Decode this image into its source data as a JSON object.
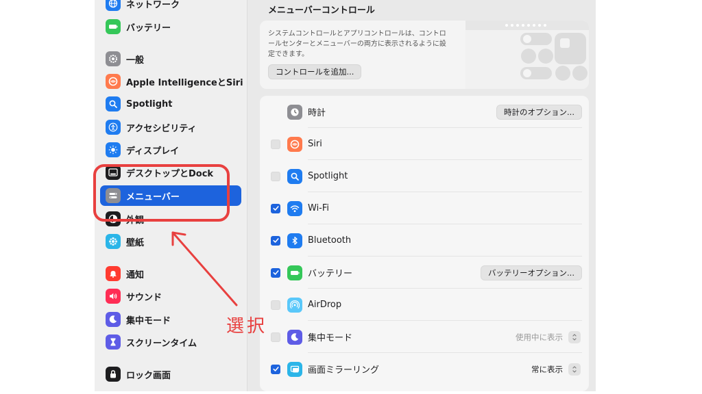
{
  "sidebar": {
    "items": [
      {
        "label": "ネットワーク",
        "icon": "globe-icon",
        "color": "#1f7cf0"
      },
      {
        "label": "バッテリー",
        "icon": "battery-icon",
        "color": "#35c759"
      },
      {
        "label": "一般",
        "icon": "gear-icon",
        "color": "#8e8e93"
      },
      {
        "label": "Apple IntelligenceとSiri",
        "icon": "siri-icon",
        "color": "#ff7a4d"
      },
      {
        "label": "Spotlight",
        "icon": "magnifier-icon",
        "color": "#1f7cf0"
      },
      {
        "label": "アクセシビリティ",
        "icon": "accessibility-icon",
        "color": "#1f7cf0"
      },
      {
        "label": "ディスプレイ",
        "icon": "sun-icon",
        "color": "#1f7cf0"
      },
      {
        "label": "デスクトップとDock",
        "icon": "dock-icon",
        "color": "#1d1d1f"
      },
      {
        "label": "メニューバー",
        "icon": "menubar-icon",
        "color": "#8e8e93",
        "selected": true
      },
      {
        "label": "外観",
        "icon": "appearance-icon",
        "color": "#1d1d1f"
      },
      {
        "label": "壁紙",
        "icon": "wallpaper-icon",
        "color": "#2bb5e8"
      },
      {
        "label": "通知",
        "icon": "bell-icon",
        "color": "#ff3b30"
      },
      {
        "label": "サウンド",
        "icon": "speaker-icon",
        "color": "#ff2d55"
      },
      {
        "label": "集中モード",
        "icon": "moon-icon",
        "color": "#5e5ce6"
      },
      {
        "label": "スクリーンタイム",
        "icon": "hourglass-icon",
        "color": "#5e5ce6"
      },
      {
        "label": "ロック画面",
        "icon": "lock-icon",
        "color": "#1d1d1f"
      }
    ]
  },
  "main": {
    "title": "メニューバーコントロール",
    "info_text": "システムコントロールとアプリコントロールは、コントロールセンターとメニューバーの両方に表示されるように設定できます。",
    "add_button": "コントロールを追加...",
    "rows": [
      {
        "label": "時計",
        "icon": "clock-icon",
        "color": "#8e8e93",
        "checkbox": null,
        "button": "時計のオプション..."
      },
      {
        "label": "Siri",
        "icon": "siri-icon",
        "color": "#ff7a4d",
        "checkbox": false
      },
      {
        "label": "Spotlight",
        "icon": "magnifier-icon",
        "color": "#1f7cf0",
        "checkbox": false
      },
      {
        "label": "Wi-Fi",
        "icon": "wifi-icon",
        "color": "#1f7cf0",
        "checkbox": true
      },
      {
        "label": "Bluetooth",
        "icon": "bluetooth-icon",
        "color": "#1f7cf0",
        "checkbox": true
      },
      {
        "label": "バッテリー",
        "icon": "battery-icon",
        "color": "#35c759",
        "checkbox": true,
        "button": "バッテリーオプション..."
      },
      {
        "label": "AirDrop",
        "icon": "airdrop-icon",
        "color": "#5ac8fa",
        "checkbox": false
      },
      {
        "label": "集中モード",
        "icon": "moon-icon",
        "color": "#5e5ce6",
        "checkbox": false,
        "popup": "使用中に表示",
        "popup_dim": true
      },
      {
        "label": "画面ミラーリング",
        "icon": "mirroring-icon",
        "color": "#2bb5e8",
        "checkbox": true,
        "popup": "常に表示",
        "popup_dim": false
      }
    ]
  },
  "annotation": {
    "text": "選択",
    "color": "#e8403f"
  }
}
